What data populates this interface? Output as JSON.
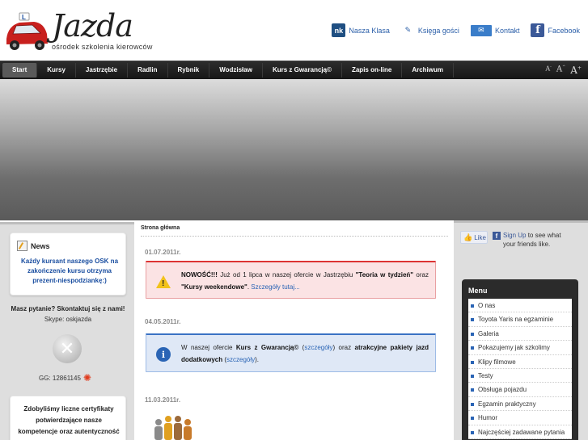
{
  "header": {
    "logo_title": "Jazda",
    "logo_subtitle": "ośrodek szkolenia kierowców",
    "links": [
      {
        "label": "Nasza Klasa",
        "icon": "nk-icon",
        "icon_text": "nk"
      },
      {
        "label": "Księga gości",
        "icon": "guestbook-icon",
        "icon_text": "✎"
      },
      {
        "label": "Kontakt",
        "icon": "mail-icon",
        "icon_text": "✉"
      },
      {
        "label": "Facebook",
        "icon": "facebook-icon",
        "icon_text": "f"
      }
    ]
  },
  "nav": {
    "items": [
      "Start",
      "Kursy",
      "Jastrzębie",
      "Radlin",
      "Rybnik",
      "Wodzisław",
      "Kurs z Gwarancją©",
      "Zapis on-line",
      "Archiwum"
    ],
    "active": "Start",
    "font_sizes": [
      "A-",
      "A^",
      "A+"
    ]
  },
  "left": {
    "news_title": "News",
    "news_text": "Każdy kursant naszego OSK na zakończenie kursu otrzyma prezent-niespodziankę:)",
    "ask": "Masz pytanie? Skontaktuj się z nami!",
    "skype": "Skype: oskjazda",
    "skype_status_icon": "✕",
    "gg": "GG: 12861145",
    "cert_text": "Zdobyliśmy liczne certyfikaty potwierdzające nasze kompetencje oraz autentyczność"
  },
  "main": {
    "breadcrumb": "Strona główna",
    "posts": [
      {
        "date": "01.07.2011r.",
        "type": "warning",
        "parts": {
          "p1_bold": "NOWOŚĆ!!!",
          "p1": " Już od 1 lipca w naszej ofercie w Jastrzębiu ",
          "p2_bold": "\"Teoria w tydzień\"",
          "p2": " oraz ",
          "p3_bold": "\"Kursy weekendowe\"",
          "p3": ". ",
          "link": "Szczegóły tutaj..."
        }
      },
      {
        "date": "04.05.2011r.",
        "type": "info",
        "parts": {
          "p1": "W naszej ofercie ",
          "p2_bold": "Kurs z Gwarancją©",
          "p2": " (",
          "link1": "szczegóły",
          "p3": ")  oraz ",
          "p4_bold": "atrakcyjne pakiety jazd dodatkowych",
          "p4": " (",
          "link2": "szczegóły",
          "p5": ")."
        }
      },
      {
        "date": "11.03.2011r."
      }
    ]
  },
  "right": {
    "like_label": "Like",
    "signup_link": "Sign Up",
    "signup_text": " to see what your friends like.",
    "menu_title": "Menu",
    "menu_items": [
      "O nas",
      "Toyota Yaris na egzaminie",
      "Galeria",
      "Pokazujemy jak szkolimy",
      "Klipy filmowe",
      "Testy",
      "Obsługa pojazdu",
      "Egzamin praktyczny",
      "Humor",
      "Najczęściej zadawane pytania"
    ]
  },
  "colors": {
    "nav_bg": "#1e1e1e",
    "link_blue": "#2a64b5",
    "warning_bg": "#fbe3e4",
    "info_bg": "#dfe8f6",
    "sidebar_bg": "#dedede"
  }
}
